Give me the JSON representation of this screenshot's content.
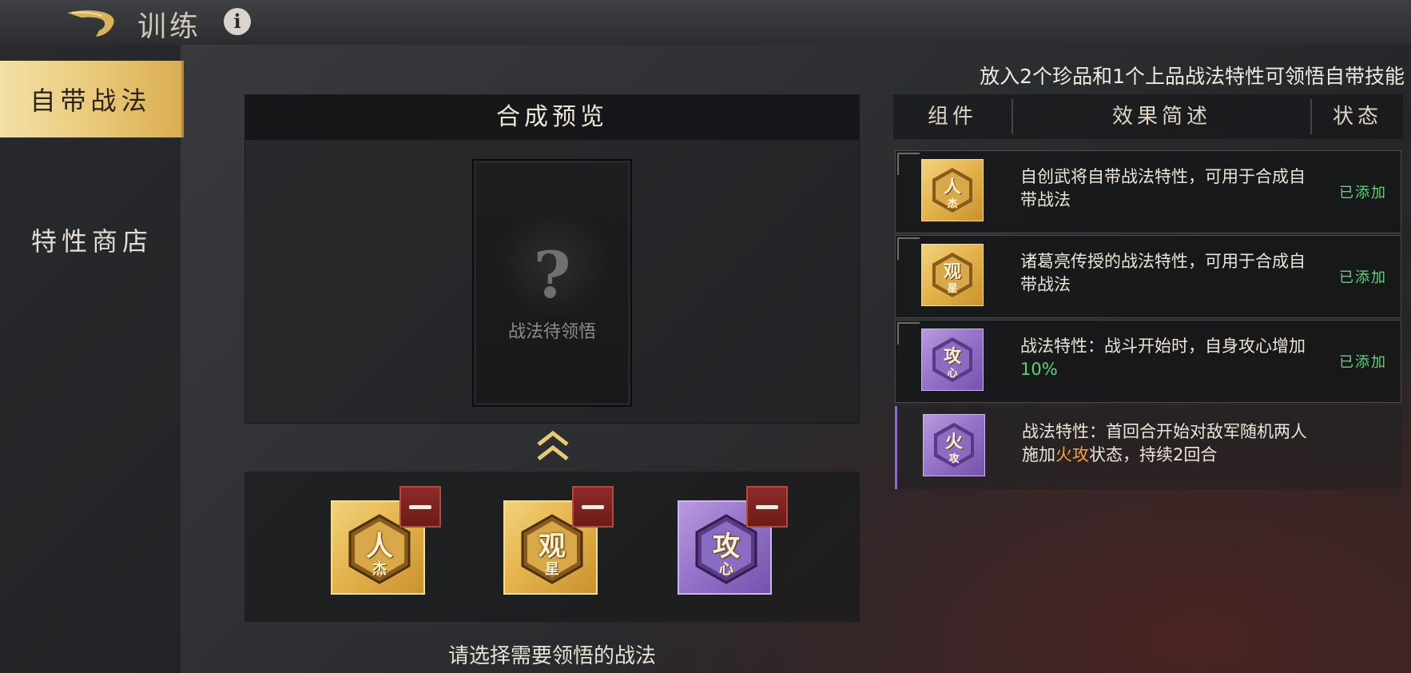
{
  "header": {
    "title": "训练",
    "info_icon": "info-icon",
    "back_icon": "back-arrow-icon"
  },
  "sidebar": {
    "items": [
      {
        "label": "自带战法",
        "active": true
      },
      {
        "label": "特性商店",
        "active": false
      }
    ]
  },
  "preview": {
    "title": "合成预览",
    "card_placeholder_symbol": "?",
    "card_label": "战法待领悟"
  },
  "slots": [
    {
      "main": "人",
      "sub": "杰",
      "color": "gold"
    },
    {
      "main": "观",
      "sub": "星",
      "color": "gold"
    },
    {
      "main": "攻",
      "sub": "心",
      "color": "purple"
    }
  ],
  "hint": "请选择需要领悟的战法",
  "right": {
    "title": "放入2个珍品和1个上品战法特性可领悟自带技能",
    "columns": [
      "组件",
      "效果简述",
      "状态"
    ],
    "rows": [
      {
        "icon_main": "人",
        "icon_sub": "杰",
        "color": "gold",
        "desc": "自创武将自带战法特性，可用于合成自带战法",
        "status": "已添加"
      },
      {
        "icon_main": "观",
        "icon_sub": "星",
        "color": "gold",
        "desc": "诸葛亮传授的战法特性，可用于合成自带战法",
        "status": "已添加"
      },
      {
        "icon_main": "攻",
        "icon_sub": "心",
        "color": "purple",
        "desc_prefix": "战法特性：战斗开始时，自身攻心增加",
        "desc_highlight": "10%",
        "desc_suffix": "",
        "status": "已添加"
      },
      {
        "icon_main": "火",
        "icon_sub": "攻",
        "color": "purple",
        "desc_prefix": "战法特性：首回合开始对敌军随机两人施加",
        "desc_highlight": "火攻",
        "desc_suffix": "状态，持续2回合",
        "status": ""
      }
    ]
  },
  "colors": {
    "gold": "#e3b24a",
    "purple": "#9372c8",
    "added_green": "#5fd37a",
    "highlight_orange": "#f0a640",
    "remove_red": "#8e2a26"
  }
}
